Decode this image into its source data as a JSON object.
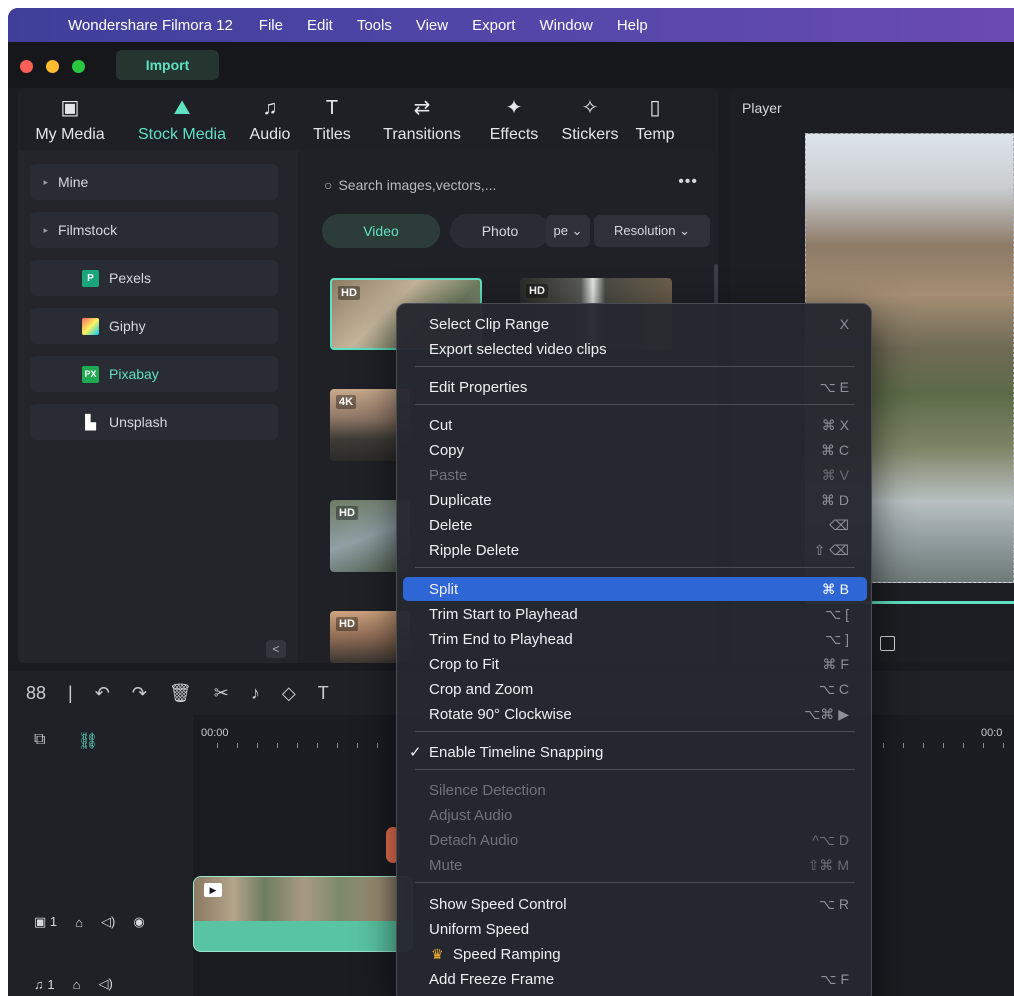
{
  "menubar": {
    "apple": "",
    "app_name": "Wondershare Filmora 12",
    "items": [
      "File",
      "Edit",
      "Tools",
      "View",
      "Export",
      "Window",
      "Help"
    ]
  },
  "titlebar": {
    "import_label": "Import"
  },
  "media_tabs": [
    {
      "label": "My Media",
      "icon": "my-media-icon",
      "glyph": "▣"
    },
    {
      "label": "Stock Media",
      "icon": "stock-media-icon",
      "glyph": "⛰"
    },
    {
      "label": "Audio",
      "icon": "audio-icon",
      "glyph": "♫"
    },
    {
      "label": "Titles",
      "icon": "titles-icon",
      "glyph": "T"
    },
    {
      "label": "Transitions",
      "icon": "transitions-icon",
      "glyph": "⇄"
    },
    {
      "label": "Effects",
      "icon": "effects-icon",
      "glyph": "✦"
    },
    {
      "label": "Stickers",
      "icon": "stickers-icon",
      "glyph": "✧"
    },
    {
      "label": "Temp",
      "icon": "templates-icon",
      "glyph": "▯"
    }
  ],
  "sidebar": {
    "items": [
      {
        "label": "Mine",
        "type": "folder"
      },
      {
        "label": "Filmstock",
        "type": "folder"
      },
      {
        "label": "Pexels",
        "type": "source",
        "logo": "P",
        "color": "#1ba57a"
      },
      {
        "label": "Giphy",
        "type": "source",
        "logo": "",
        "color": "#ff6666"
      },
      {
        "label": "Pixabay",
        "type": "source",
        "logo": "PX",
        "color": "#1eaa50",
        "active": true
      },
      {
        "label": "Unsplash",
        "type": "source",
        "logo": "▙",
        "color": "#ffffff"
      }
    ],
    "collapse_glyph": "<"
  },
  "search": {
    "placeholder": "Search images,vectors,...",
    "more": "•••"
  },
  "filters": {
    "video": "Video",
    "photo": "Photo",
    "type_label": "pe ⌄",
    "resolution_label": "Resolution ⌄"
  },
  "thumbnails": [
    {
      "badge": "HD"
    },
    {
      "badge": "HD"
    },
    {
      "badge": "4K"
    },
    {
      "badge": "HD"
    },
    {
      "badge": "HD"
    }
  ],
  "player": {
    "title": "Player"
  },
  "timeline": {
    "toolbar_icons": [
      "88",
      "|",
      "↶",
      "↷",
      "🗑",
      "✂",
      "♪",
      "◇",
      "T"
    ],
    "ruler_start": "00:00",
    "ruler_end": "00:0",
    "track_video": "1",
    "track_audio": "1"
  },
  "context_menu": {
    "items": [
      {
        "label": "Select Clip Range",
        "shortcut": "X",
        "disabled": false
      },
      {
        "label": "Export selected video clips",
        "shortcut": "",
        "disabled": false
      },
      {
        "sep": true
      },
      {
        "label": "Edit Properties",
        "shortcut": "⌥ E",
        "disabled": false
      },
      {
        "sep": true
      },
      {
        "label": "Cut",
        "shortcut": "⌘ X",
        "disabled": false
      },
      {
        "label": "Copy",
        "shortcut": "⌘ C",
        "disabled": false
      },
      {
        "label": "Paste",
        "shortcut": "⌘ V",
        "disabled": true
      },
      {
        "label": "Duplicate",
        "shortcut": "⌘ D",
        "disabled": false
      },
      {
        "label": "Delete",
        "shortcut": "⌫",
        "disabled": false
      },
      {
        "label": "Ripple Delete",
        "shortcut": "⇧ ⌫",
        "disabled": false
      },
      {
        "sep": true
      },
      {
        "label": "Split",
        "shortcut": "⌘ B",
        "disabled": false,
        "selected": true
      },
      {
        "label": "Trim Start to Playhead",
        "shortcut": "⌥ [",
        "disabled": false
      },
      {
        "label": "Trim End to Playhead",
        "shortcut": "⌥ ]",
        "disabled": false
      },
      {
        "label": "Crop to Fit",
        "shortcut": "⌘ F",
        "disabled": false
      },
      {
        "label": "Crop and Zoom",
        "shortcut": "⌥ C",
        "disabled": false
      },
      {
        "label": "Rotate 90° Clockwise",
        "shortcut": "⌥⌘ ▶",
        "disabled": false
      },
      {
        "sep": true
      },
      {
        "label": "Enable Timeline Snapping",
        "shortcut": "",
        "disabled": false,
        "checked": true
      },
      {
        "sep": true
      },
      {
        "label": "Silence Detection",
        "shortcut": "",
        "disabled": true
      },
      {
        "label": "Adjust Audio",
        "shortcut": "",
        "disabled": true
      },
      {
        "label": "Detach Audio",
        "shortcut": "^⌥ D",
        "disabled": true
      },
      {
        "label": "Mute",
        "shortcut": "⇧⌘ M",
        "disabled": true
      },
      {
        "sep": true
      },
      {
        "label": "Show Speed Control",
        "shortcut": "⌥ R",
        "disabled": false
      },
      {
        "label": "Uniform Speed",
        "shortcut": "",
        "disabled": false
      },
      {
        "label": "Speed Ramping",
        "shortcut": "",
        "disabled": false,
        "crown": true
      },
      {
        "label": "Add Freeze Frame",
        "shortcut": "⌥ F",
        "disabled": false
      }
    ]
  }
}
